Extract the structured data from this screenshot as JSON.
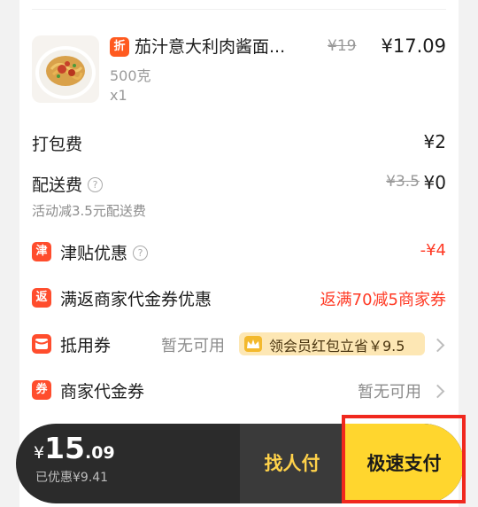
{
  "product": {
    "discount_badge": "折",
    "title": "茄汁意大利肉酱面...",
    "original_price": "¥19",
    "price": "¥17.09",
    "spec": "500克",
    "quantity": "x1",
    "image_icon": "pasta-dish-image"
  },
  "fees": {
    "packing_label": "打包费",
    "packing_value": "¥2",
    "delivery_label": "配送费",
    "delivery_original": "¥3.5",
    "delivery_value": "¥0",
    "delivery_note": "活动减3.5元配送费"
  },
  "discounts": {
    "subsidy_badge": "津",
    "subsidy_label": "津贴优惠",
    "subsidy_value": "-¥4",
    "rebate_badge": "返",
    "rebate_label": "满返商家代金券优惠",
    "rebate_value": "返满70减5商家券",
    "coupon_label": "抵用券",
    "coupon_value": "暂无可用",
    "vip_promo": "领会员红包立省￥9.5",
    "voucher_badge": "券",
    "voucher_label": "商家代金券",
    "voucher_value": "暂无可用"
  },
  "checkout": {
    "currency": "¥",
    "total_int": "15",
    "total_dec": ".09",
    "saved": "已优惠¥9.41",
    "find_pay": "找人付",
    "fast_pay": "极速支付"
  },
  "colors": {
    "accent_red": "#ff3a25",
    "pay_yellow": "#ffd62e",
    "highlight_red": "#f0281e"
  }
}
